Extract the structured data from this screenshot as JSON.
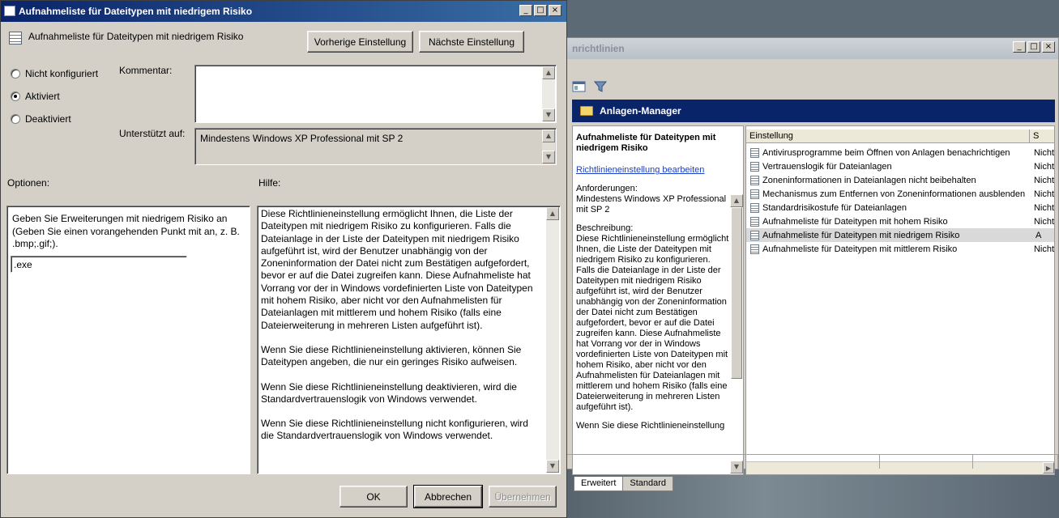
{
  "dialog": {
    "title": "Aufnahmeliste für Dateitypen mit niedrigem Risiko",
    "policy_name": "Aufnahmeliste für Dateitypen mit niedrigem Risiko",
    "prev_button": "Vorherige Einstellung",
    "next_button": "Nächste Einstellung",
    "radio_not_configured": "Nicht konfiguriert",
    "radio_enabled": "Aktiviert",
    "radio_disabled": "Deaktiviert",
    "selected_state": "Aktiviert",
    "comment_label": "Kommentar:",
    "comment_value": "",
    "supported_label": "Unterstützt auf:",
    "supported_value": "Mindestens Windows XP Professional mit SP 2",
    "options_label": "Optionen:",
    "help_label": "Hilfe:",
    "option_description": "Geben Sie Erweiterungen mit niedrigem Risiko an (Geben Sie einen vorangehenden Punkt mit an, z. B. .bmp;.gif;).",
    "option_value": ".exe",
    "help_paragraphs": [
      "Diese Richtlinieneinstellung ermöglicht Ihnen, die Liste der Dateitypen mit niedrigem Risiko zu konfigurieren. Falls die Dateianlage in der Liste der Dateitypen mit niedrigem Risiko aufgeführt ist, wird der Benutzer unabhängig von der Zoneninformation der Datei nicht zum Bestätigen aufgefordert, bevor er auf die Datei zugreifen kann. Diese Aufnahmeliste hat Vorrang vor der in Windows vordefinierten Liste von Dateitypen mit hohem Risiko, aber nicht vor den Aufnahmelisten für Dateianlagen mit mittlerem und hohem Risiko (falls eine Dateierweiterung in mehreren Listen aufgeführt ist).",
      "Wenn Sie diese Richtlinieneinstellung aktivieren, können Sie Dateitypen angeben, die nur ein geringes Risiko aufweisen.",
      "Wenn Sie diese Richtlinieneinstellung deaktivieren, wird die Standardvertrauenslogik von Windows verwendet.",
      "Wenn Sie diese Richtlinieneinstellung nicht konfigurieren, wird die Standardvertrauenslogik von Windows verwendet."
    ],
    "ok_button": "OK",
    "cancel_button": "Abbrechen",
    "apply_button": "Übernehmen",
    "caption_minimize": "_",
    "caption_maximize": "□",
    "caption_close": "×"
  },
  "background_window": {
    "title_fragment": "nrichtlinien",
    "header": "Anlagen-Manager",
    "ext_title": "Aufnahmeliste für Dateitypen mit niedrigem Risiko",
    "ext_link": "Richtlinieneinstellung bearbeiten",
    "requirements_label": "Anforderungen:",
    "requirements_value": "Mindestens Windows XP Professional mit SP 2",
    "description_label": "Beschreibung:",
    "description_text": "Diese Richtlinieneinstellung ermöglicht Ihnen, die Liste der Dateitypen mit niedrigem Risiko zu konfigurieren. Falls die Dateianlage in der Liste der Dateitypen mit niedrigem Risiko aufgeführt ist, wird der Benutzer unabhängig von der Zoneninformation der Datei nicht zum Bestätigen aufgefordert, bevor er auf die Datei zugreifen kann. Diese Aufnahmeliste hat Vorrang vor der in Windows vordefinierten Liste von Dateitypen mit hohem Risiko, aber nicht vor den Aufnahmelisten für Dateianlagen mit mittlerem und hohem Risiko (falls eine Dateierweiterung in mehreren Listen aufgeführt ist).",
    "description_more": "Wenn Sie diese Richtlinieneinstellung",
    "column_setting": "Einstellung",
    "column_state": "S",
    "rows": [
      {
        "name": "Antivirusprogramme beim Öffnen von Anlagen benachrichtigen",
        "state": "Nicht"
      },
      {
        "name": "Vertrauenslogik für Dateianlagen",
        "state": "Nicht"
      },
      {
        "name": "Zoneninformationen in Dateianlagen nicht beibehalten",
        "state": "Nicht"
      },
      {
        "name": "Mechanismus zum Entfernen von Zoneninformationen ausblenden",
        "state": "Nicht"
      },
      {
        "name": "Standardrisikostufe für Dateianlagen",
        "state": "Nicht"
      },
      {
        "name": "Aufnahmeliste für Dateitypen mit hohem Risiko",
        "state": "Nicht"
      },
      {
        "name": "Aufnahmeliste für Dateitypen mit niedrigem Risiko",
        "state": "A"
      },
      {
        "name": "Aufnahmeliste für Dateitypen mit mittlerem Risiko",
        "state": "Nicht"
      }
    ],
    "tab_extended": "Erweitert",
    "tab_standard": "Standard"
  }
}
